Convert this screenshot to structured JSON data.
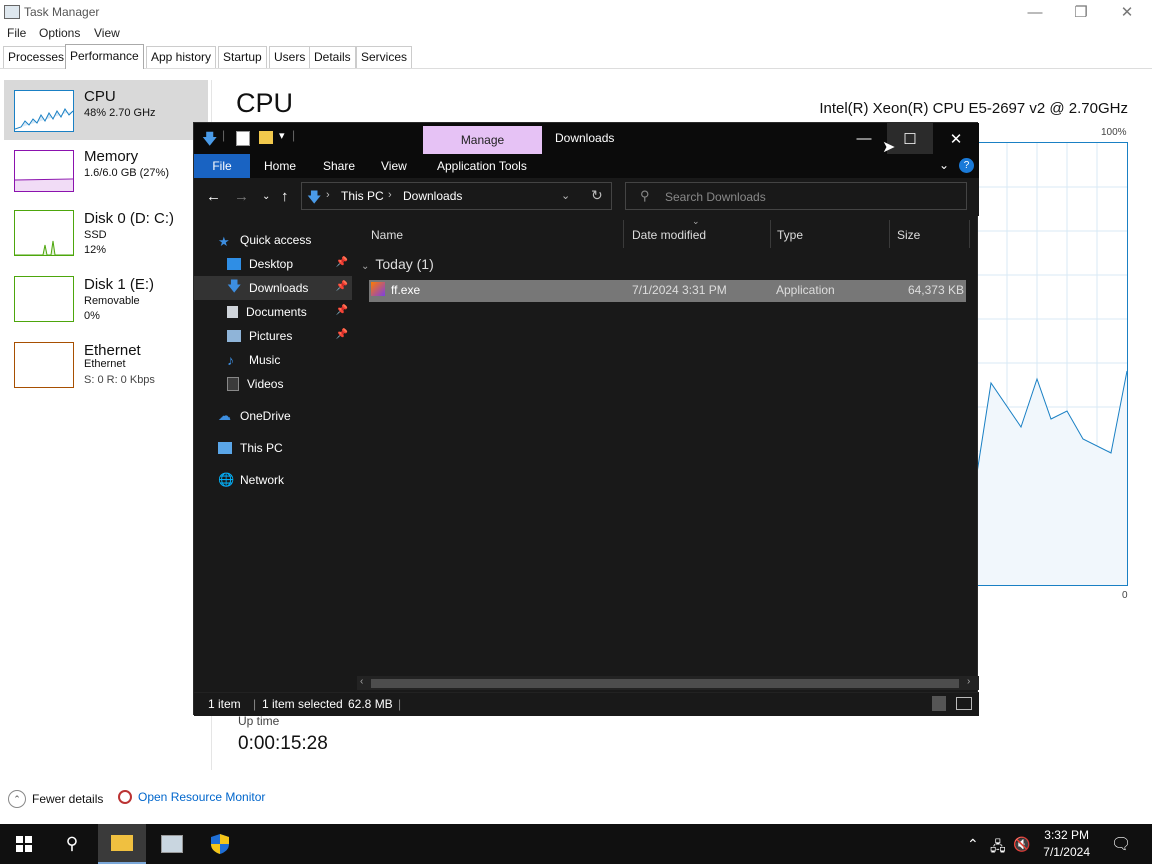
{
  "taskmanager": {
    "title": "Task Manager",
    "menu": [
      "File",
      "Options",
      "View"
    ],
    "tabs": [
      "Processes",
      "Performance",
      "App history",
      "Startup",
      "Users",
      "Details",
      "Services"
    ],
    "sidebar": [
      {
        "name": "CPU",
        "line1": "48%  2.70 GHz",
        "line2": "",
        "line3": ""
      },
      {
        "name": "Memory",
        "line1": "1.6/6.0 GB (27%)",
        "line2": "",
        "line3": ""
      },
      {
        "name": "Disk 0 (D: C:)",
        "line1": "SSD",
        "line2": "12%",
        "line3": ""
      },
      {
        "name": "Disk 1 (E:)",
        "line1": "Removable",
        "line2": "0%",
        "line3": ""
      },
      {
        "name": "Ethernet",
        "line1": "Ethernet",
        "line2": "S: 0 R: 0 Kbps",
        "line3": ""
      }
    ],
    "heading": "CPU",
    "cpu_model": "Intel(R) Xeon(R) CPU E5-2697 v2 @ 2.70GHz",
    "graph_max": "100%",
    "graph_min": "0",
    "uptime_label": "Up time",
    "uptime_value": "0:00:15:28",
    "fewer_details": "Fewer details",
    "open_resource_monitor": "Open Resource Monitor",
    "colors": {
      "cpu": "#1a80c4",
      "memory": "#8b12ae",
      "disk": "#4da60c",
      "ethernet": "#a74f01"
    }
  },
  "explorer": {
    "manage_tab": "Manage",
    "title": "Downloads",
    "ribbon": {
      "file": "File",
      "home": "Home",
      "share": "Share",
      "view": "View",
      "app_tools": "Application Tools"
    },
    "address": {
      "this_pc": "This PC",
      "downloads": "Downloads"
    },
    "search_placeholder": "Search Downloads",
    "nav": {
      "quick_access": "Quick access",
      "desktop": "Desktop",
      "downloads": "Downloads",
      "documents": "Documents",
      "pictures": "Pictures",
      "music": "Music",
      "videos": "Videos",
      "onedrive": "OneDrive",
      "this_pc": "This PC",
      "network": "Network"
    },
    "columns": {
      "name": "Name",
      "date": "Date modified",
      "type": "Type",
      "size": "Size"
    },
    "group": "Today (1)",
    "file": {
      "name": "ff.exe",
      "date": "7/1/2024 3:31 PM",
      "type": "Application",
      "size": "64,373 KB"
    },
    "status": {
      "count": "1 item",
      "selected": "1 item selected",
      "size": "62.8 MB"
    }
  },
  "taskbar": {
    "time": "3:32 PM",
    "date": "7/1/2024"
  }
}
